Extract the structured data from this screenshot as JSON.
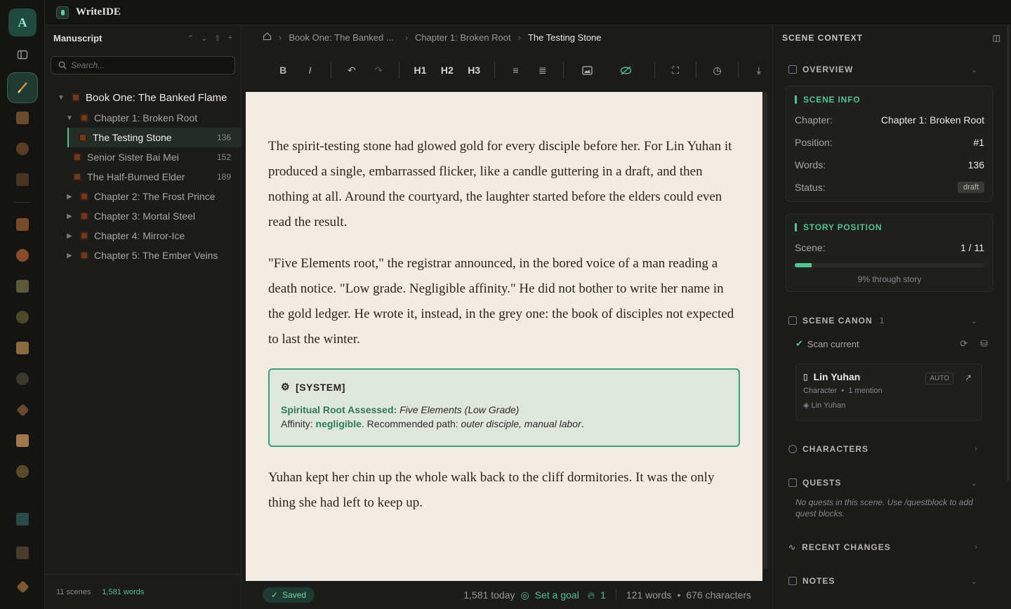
{
  "app": {
    "title": "WriteIDE",
    "avatar_letter": "A",
    "accent": "#4fc491"
  },
  "sidebar": {
    "title": "Manuscript",
    "search_placeholder": "Search...",
    "book": "Book One: The Banked Flame",
    "tree": [
      {
        "label": "Chapter 1: Broken Root",
        "type": "chapter",
        "expanded": true
      },
      {
        "label": "The Testing Stone",
        "type": "scene",
        "count": "136",
        "active": true
      },
      {
        "label": "Senior Sister Bai Mei",
        "type": "scene",
        "count": "152"
      },
      {
        "label": "The Half-Burned Elder",
        "type": "scene",
        "count": "189"
      },
      {
        "label": "Chapter 2: The Frost Prince",
        "type": "chapter"
      },
      {
        "label": "Chapter 3: Mortal Steel",
        "type": "chapter"
      },
      {
        "label": "Chapter 4: Mirror-Ice",
        "type": "chapter"
      },
      {
        "label": "Chapter 5: The Ember Veins",
        "type": "chapter"
      }
    ],
    "footer": {
      "scenes": "11 scenes",
      "words": "1,581 words"
    }
  },
  "breadcrumb": {
    "book": "Book One: The Banked ...",
    "chapter": "Chapter 1: Broken Root",
    "scene": "The Testing Stone"
  },
  "toolbar": {
    "h1": "H1",
    "h2": "H2",
    "h3": "H3"
  },
  "editor": {
    "p1": "The spirit-testing stone had glowed gold for every disciple before her. For Lin Yuhan it produced a single, embarrassed flicker, like a candle guttering in a draft, and then nothing at all. Around the courtyard, the laughter started before the elders could even read the result.",
    "p2": "\"Five Elements root,\" the registrar announced, in the bored voice of a man reading a death notice. \"Low grade. Negligible affinity.\" He did not bother to write her name in the gold ledger. He wrote it, instead, in the grey one: the book of disciples not expected to last the winter.",
    "system": {
      "header": "[SYSTEM]",
      "l1_label": "Spiritual Root Assessed:",
      "l1_value": "Five Elements (Low Grade)",
      "l2_label": "Affinity:",
      "l2_value": "negligible",
      "l2_mid": ". Recommended path:",
      "l2_path": "outer disciple, manual labor",
      "l2_end": "."
    },
    "p3": "Yuhan kept her chin up the whole walk back to the cliff dormitories. It was the only thing she had left to keep up."
  },
  "status": {
    "saved": "Saved",
    "today": "1,581 today",
    "goal": "Set a goal",
    "streak": "1",
    "words": "121 words",
    "chars": "676 characters"
  },
  "context": {
    "title": "SCENE CONTEXT",
    "overview": "OVERVIEW",
    "scene_info": {
      "title": "SCENE INFO",
      "chapter_label": "Chapter:",
      "chapter": "Chapter 1: Broken Root",
      "position_label": "Position:",
      "position": "#1",
      "words_label": "Words:",
      "words": "136",
      "status_label": "Status:",
      "status": "draft"
    },
    "story_position": {
      "title": "STORY POSITION",
      "scene_label": "Scene:",
      "scene": "1 / 11",
      "progress": 0.09,
      "progress_text": "9% through story"
    },
    "canon": {
      "title": "SCENE CANON",
      "count": "1",
      "scan": "Scan current",
      "entry": {
        "name": "Lin Yuhan",
        "type": "Character",
        "mentions": "1 mention",
        "alias": "Lin Yuhan",
        "badge": "AUTO"
      }
    },
    "characters": "CHARACTERS",
    "quests": "QUESTS",
    "quests_empty": "No quests in this scene. Use /questblock to add quest blocks.",
    "recent": "RECENT CHANGES",
    "notes": "NOTES"
  }
}
